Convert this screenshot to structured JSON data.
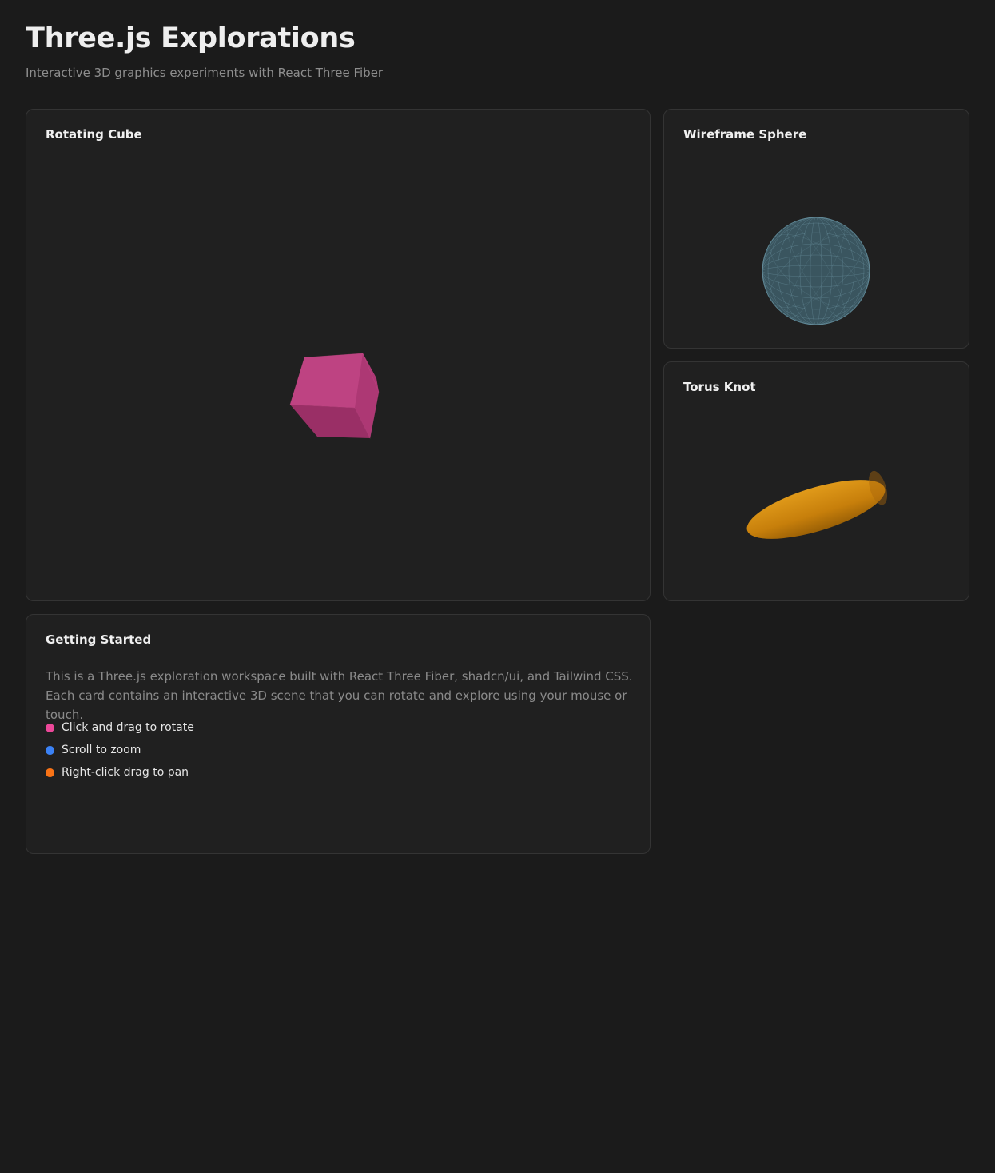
{
  "header": {
    "title": "Three.js Explorations",
    "subtitle": "Interactive 3D graphics experiments with React Three Fiber"
  },
  "cards": {
    "cube": {
      "title": "Rotating Cube",
      "color": "#c2407f"
    },
    "sphere": {
      "title": "Wireframe Sphere",
      "color": "#3e5a66"
    },
    "torus": {
      "title": "Torus Knot",
      "color": "#d4870c"
    }
  },
  "getting_started": {
    "title": "Getting Started",
    "description": "This is a Three.js exploration workspace built with React Three Fiber, shadcn/ui, and Tailwind CSS. Each card contains an interactive 3D scene that you can rotate and explore using your mouse or touch.",
    "tips": [
      {
        "label": "Click and drag to rotate",
        "color": "#ec4899"
      },
      {
        "label": "Scroll to zoom",
        "color": "#3b82f6"
      },
      {
        "label": "Right-click drag to pan",
        "color": "#f97316"
      }
    ]
  }
}
